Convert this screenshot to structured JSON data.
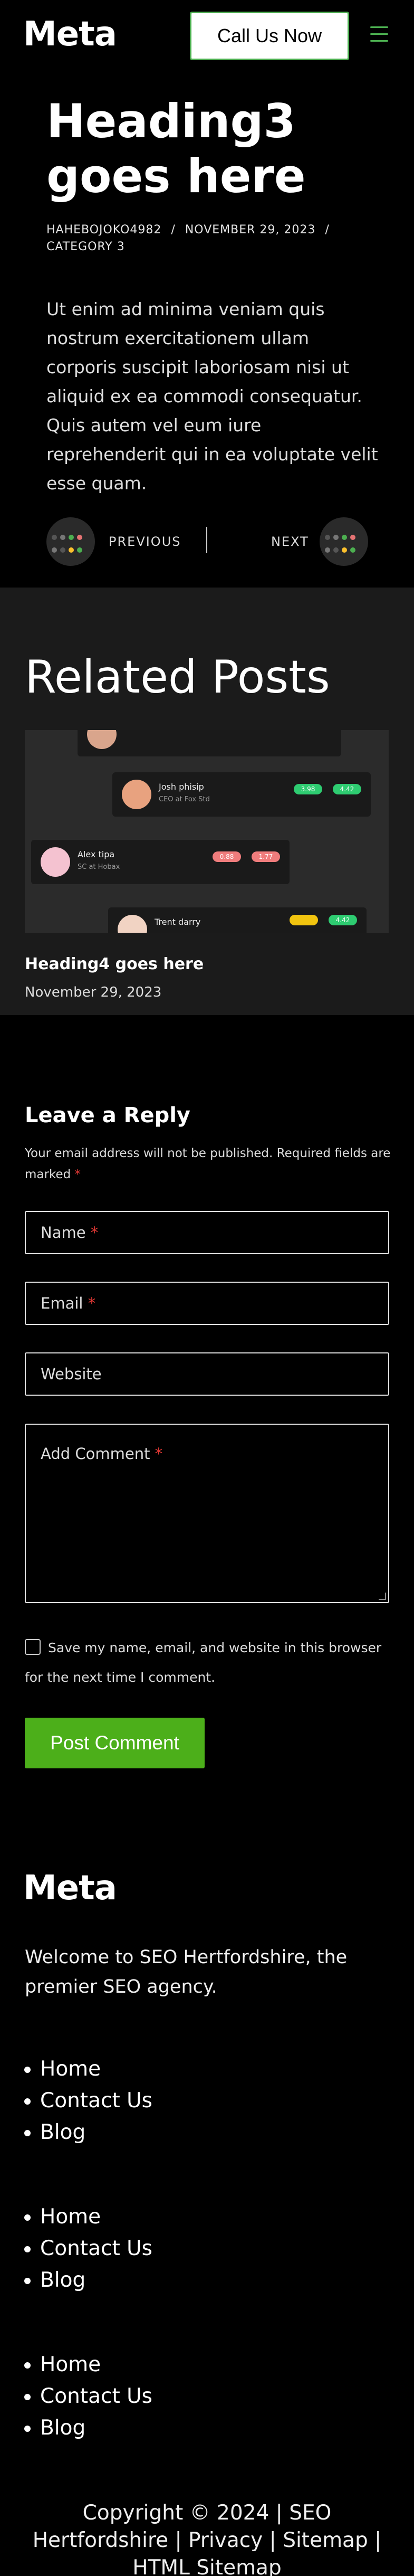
{
  "header": {
    "logo": "Meta",
    "cta": "Call Us Now"
  },
  "post": {
    "title": "Heading3 goes here",
    "author": "HAHEBOJOKO4982",
    "date": "NOVEMBER 29, 2023",
    "category": "CATEGORY 3",
    "separator": "/",
    "excerpt": "Ut enim ad minima veniam quis nostrum exercitationem ullam corporis suscipit laboriosam nisi ut aliquid ex ea commodi consequatur. Quis autem vel eum iure reprehenderit qui in ea voluptate velit esse quam."
  },
  "post_nav": {
    "previous": "PREVIOUS",
    "next": "NEXT"
  },
  "related": {
    "heading": "Related Posts",
    "thumb_cards": [
      {
        "name": "Josh phisip",
        "role": "CEO at Fox Std",
        "v1": "3.98",
        "v2": "4.42"
      },
      {
        "name": "Alex tipa",
        "role": "SC at Hobax",
        "v1": "0.88",
        "v2": "1.77"
      },
      {
        "name": "Trent darry",
        "role": "",
        "v1": "",
        "v2": "4.42"
      }
    ],
    "post_title": "Heading4 goes here",
    "post_date": "November 29, 2023"
  },
  "reply": {
    "heading": "Leave a Reply",
    "note": "Your email address will not be published. Required fields are marked",
    "required_mark": "*",
    "name_placeholder": "Name",
    "email_placeholder": "Email",
    "website_placeholder": "Website",
    "comment_placeholder": "Add Comment",
    "consent": "Save my name, email, and website in this browser for the next time I comment.",
    "submit": "Post Comment"
  },
  "footer": {
    "logo": "Meta",
    "description": "Welcome to SEO Hertfordshire, the premier SEO agency.",
    "menus": [
      [
        "Home",
        "Contact Us",
        "Blog"
      ],
      [
        "Home",
        "Contact Us",
        "Blog"
      ],
      [
        "Home",
        "Contact Us",
        "Blog"
      ]
    ],
    "copyright": "Copyright © 2024 | SEO Hertfordshire | Privacy | Sitemap | HTML Sitemap"
  }
}
